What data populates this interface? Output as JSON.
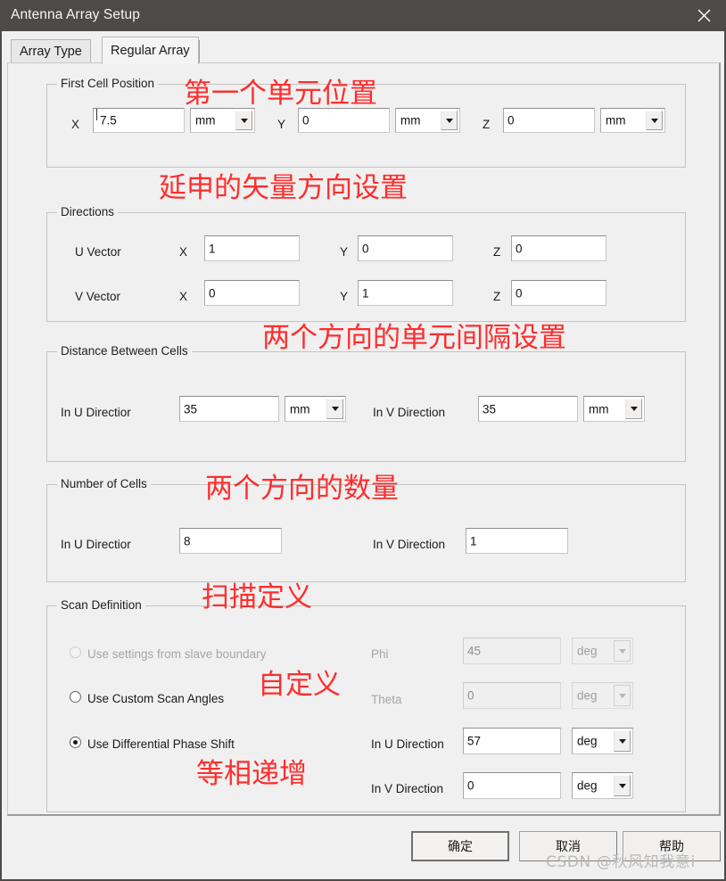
{
  "window": {
    "title": "Antenna Array Setup",
    "close_icon": "close-icon"
  },
  "tabs": [
    {
      "label": "Array Type",
      "active": false
    },
    {
      "label": "Regular Array",
      "active": true
    }
  ],
  "groups": {
    "first_cell_position": {
      "legend": "First Cell Position",
      "fields": [
        {
          "label": "X",
          "value": "7.5",
          "unit": "mm"
        },
        {
          "label": "Y",
          "value": "0",
          "unit": "mm"
        },
        {
          "label": "Z",
          "value": "0",
          "unit": "mm"
        }
      ]
    },
    "directions": {
      "legend": "Directions",
      "rows": [
        {
          "label": "U Vector",
          "components": [
            {
              "label": "X",
              "value": "1"
            },
            {
              "label": "Y",
              "value": "0"
            },
            {
              "label": "Z",
              "value": "0"
            }
          ]
        },
        {
          "label": "V Vector",
          "components": [
            {
              "label": "X",
              "value": "0"
            },
            {
              "label": "Y",
              "value": "1"
            },
            {
              "label": "Z",
              "value": "0"
            }
          ]
        }
      ]
    },
    "distance_between_cells": {
      "legend": "Distance Between Cells",
      "fields": [
        {
          "label": "In U Directior",
          "value": "35",
          "unit": "mm"
        },
        {
          "label": "In V Direction",
          "value": "35",
          "unit": "mm"
        }
      ]
    },
    "number_of_cells": {
      "legend": "Number of Cells",
      "fields": [
        {
          "label": "In U Directior",
          "value": "8"
        },
        {
          "label": "In V Direction",
          "value": "1"
        }
      ]
    },
    "scan_definition": {
      "legend": "Scan Definition",
      "options": [
        {
          "label": "Use settings from slave boundary",
          "selected": false,
          "enabled": false
        },
        {
          "label": "Use Custom Scan Angles",
          "selected": false,
          "enabled": true
        },
        {
          "label": "Use Differential Phase Shift",
          "selected": true,
          "enabled": true
        }
      ],
      "angle_fields": [
        {
          "label": "Phi",
          "value": "45",
          "unit": "deg",
          "enabled": false
        },
        {
          "label": "Theta",
          "value": "0",
          "unit": "deg",
          "enabled": false
        },
        {
          "label": "In U Direction",
          "value": "57",
          "unit": "deg",
          "enabled": true
        },
        {
          "label": "In V Direction",
          "value": "0",
          "unit": "deg",
          "enabled": true
        }
      ]
    }
  },
  "buttons": [
    {
      "label": "确定",
      "default": true
    },
    {
      "label": "取消",
      "default": false
    },
    {
      "label": "帮助",
      "default": false
    }
  ],
  "annotations": [
    {
      "text": "第一个单元位置"
    },
    {
      "text": "延申的矢量方向设置"
    },
    {
      "text": "两个方向的单元间隔设置"
    },
    {
      "text": "两个方向的数量"
    },
    {
      "text": "扫描定义"
    },
    {
      "text": "自定义"
    },
    {
      "text": "等相递增"
    }
  ],
  "watermark": {
    "text": "CSDN @秋风知我意i"
  },
  "colors": {
    "titlebar": "#4d4a48",
    "annotation": "#ff2d2d",
    "dialog": "#f0f0f0"
  }
}
